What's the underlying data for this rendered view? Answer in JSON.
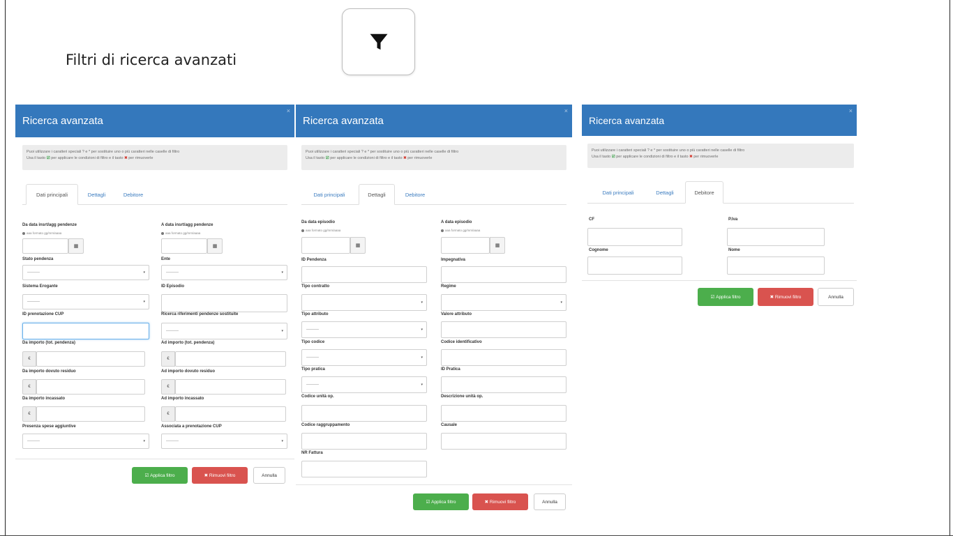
{
  "page": {
    "title": "Filtri di ricerca avanzati",
    "filter_icon": "filter-icon"
  },
  "colors": {
    "header_blue": "#3478bc",
    "apply_green": "#4cae4c",
    "remove_red": "#d9534f"
  },
  "common": {
    "header_title": "Ricerca avanzata",
    "info_line1": "Puoi utilizzare i caratteri speciali ? e * per sostituire uno o più caratteri nelle caselle di filtro",
    "info_line2_a": "Usa il tasto",
    "info_line2_b": "per applicare le condizioni di filtro e il tasto",
    "info_line2_c": "per rimuoverle",
    "tab_main": "Dati principali",
    "tab_details": "Dettagli",
    "tab_debtor": "Debitore",
    "select_placeholder": "---------",
    "format_hint": "aaa formato gg/mm/aaaa",
    "currency": "€",
    "apply": "Applica filtro",
    "remove": "Rimuovi filtro",
    "cancel": "Annulla"
  },
  "panel1": {
    "from_date": "Da data insrt/agg pendenze",
    "to_date": "A data insrt/agg pendenze",
    "stato": "Stato pendenza",
    "ente": "Ente",
    "sistema": "Sistema Erogante",
    "episodio": "ID Episodio",
    "prenotazione": "ID prenotazione CUP",
    "ricerca_rif": "Ricerca riferimenti pendenze sostituite",
    "da_importo": "Da importo (tot. pendenza)",
    "ad_importo": "Ad importo (tot. pendenza)",
    "da_residuo": "Da importo dovuto residuo",
    "ad_residuo": "Ad importo dovuto residuo",
    "da_incassato": "Da importo incassato",
    "ad_incassato": "Ad importo incassato",
    "spese": "Presenza spese aggiuntive",
    "associata": "Associata a prenotazione CUP"
  },
  "panel2": {
    "from_date": "Da data episodio",
    "to_date": "A data episodio",
    "id_pendenza": "ID Pendenza",
    "impegnativa": "Impegnativa",
    "tipo_contratto": "Tipo contratto",
    "regime": "Regime",
    "tipo_attributo": "Tipo attributo",
    "valore_attributo": "Valore attributo",
    "tipo_codice": "Tipo codice",
    "codice_identificativo": "Codice identificativo",
    "tipo_pratica": "Tipo pratica",
    "id_pratica": "ID Pratica",
    "codice_unita": "Codice unità op.",
    "descrizione_unita": "Descrizione unità op.",
    "codice_ragg": "Codice raggruppamento",
    "causale": "Causale",
    "nr_fattura": "NR Fattura"
  },
  "panel3": {
    "cf": "CF",
    "piva": "P.Iva",
    "cognome": "Cognome",
    "nome": "Nome"
  }
}
